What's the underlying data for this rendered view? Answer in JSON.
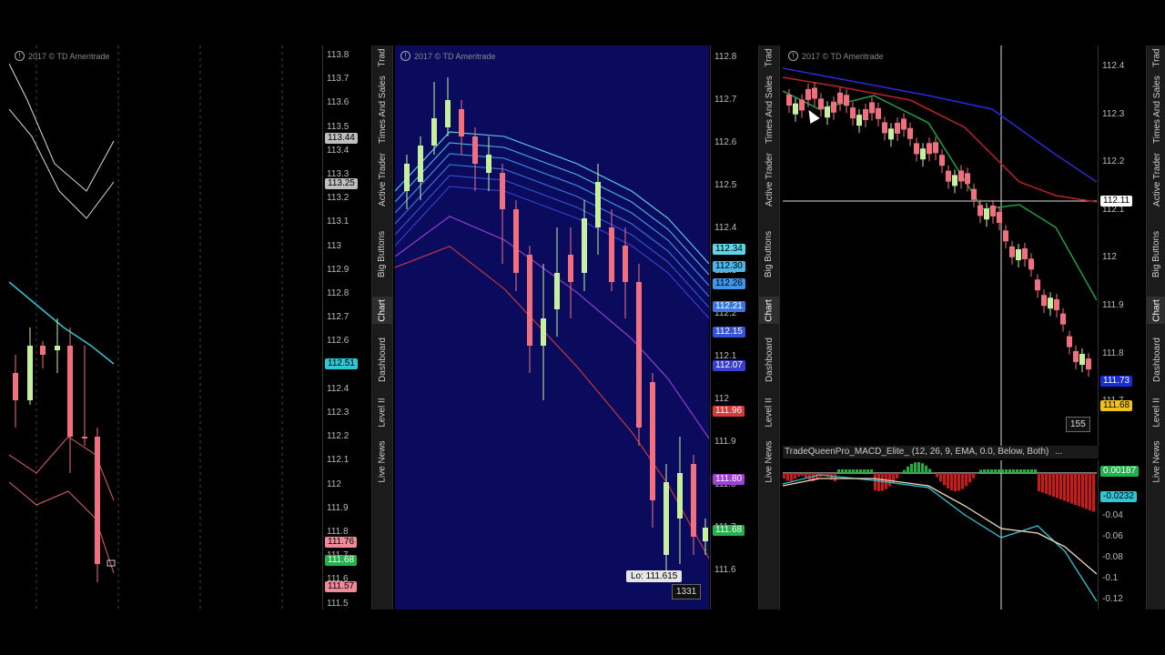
{
  "copyright": "2017 © TD Ameritrade",
  "tabs": [
    "Trad",
    "Times And Sales",
    "Active Trader",
    "Big Buttons",
    "Chart",
    "Dashboard",
    "Level II",
    "Live News"
  ],
  "active_tab": "Chart",
  "left_panel": {
    "ticks": [
      "113.8",
      "113.7",
      "113.6",
      "113.5",
      "113.4",
      "113.3",
      "113.2",
      "113.1",
      "113",
      "112.9",
      "112.8",
      "112.7",
      "112.6",
      "112.5",
      "112.4",
      "112.3",
      "112.2",
      "112.1",
      "112",
      "111.9",
      "111.8",
      "111.7",
      "111.6",
      "111.5"
    ],
    "tags": [
      {
        "text": "113.44",
        "color": "#bfbfbf",
        "text_color": "#000"
      },
      {
        "text": "113.25",
        "color": "#bfbfbf",
        "text_color": "#000"
      },
      {
        "text": "112.51",
        "color": "#2fc6d6",
        "text_color": "#000"
      },
      {
        "text": "111.76",
        "color": "#f08a9a",
        "text_color": "#000"
      },
      {
        "text": "111.68",
        "color": "#22b14c",
        "text_color": "#fff"
      },
      {
        "text": "111.57",
        "color": "#f08a9a",
        "text_color": "#000"
      }
    ]
  },
  "center_panel": {
    "ticks": [
      "112.8",
      "112.7",
      "112.6",
      "112.5",
      "112.4",
      "112.3",
      "112.2",
      "112.1",
      "112",
      "111.9",
      "111.8",
      "111.7",
      "111.6"
    ],
    "tags": [
      {
        "text": "112.34",
        "color": "#5fd5e8",
        "text_color": "#000"
      },
      {
        "text": "112.30",
        "color": "#4ab6e8",
        "text_color": "#000"
      },
      {
        "text": "112.26",
        "color": "#3f96e8",
        "text_color": "#000"
      },
      {
        "text": "112.21",
        "color": "#3a78e0",
        "text_color": "#fff"
      },
      {
        "text": "112.15",
        "color": "#3453d6",
        "text_color": "#fff"
      },
      {
        "text": "112.07",
        "color": "#3a3fd0",
        "text_color": "#fff"
      },
      {
        "text": "111.96",
        "color": "#d63a3a",
        "text_color": "#fff"
      },
      {
        "text": "111.80",
        "color": "#a040d8",
        "text_color": "#fff"
      },
      {
        "text": "111.68",
        "color": "#22b14c",
        "text_color": "#fff"
      }
    ],
    "low_label": "Lo: 111.615",
    "bar_count": "1331"
  },
  "right_panel": {
    "ticks": [
      "112.4",
      "112.3",
      "112.2",
      "112.1",
      "112",
      "111.9",
      "111.8",
      "111.7"
    ],
    "tags": [
      {
        "text": "112.11",
        "color": "#ffffff",
        "text_color": "#000"
      },
      {
        "text": "111.73",
        "color": "#1a2bd8",
        "text_color": "#fff"
      },
      {
        "text": "111.68",
        "color": "#f2c21a",
        "text_color": "#000"
      }
    ],
    "bar_count": "155",
    "study_label": "TradeQueenPro_MACD_Elite_ (12, 26, 9, EMA, 0.0, Below, Both)",
    "study_more": "...",
    "macd_ticks": [
      "-0.04",
      "-0.06",
      "-0.08",
      "-0.1",
      "-0.12"
    ],
    "macd_tags": [
      {
        "text": "0.00187",
        "color": "#22b14c",
        "text_color": "#fff"
      },
      {
        "text": "-0.0232",
        "color": "#2fc6d6",
        "text_color": "#000"
      }
    ]
  }
}
